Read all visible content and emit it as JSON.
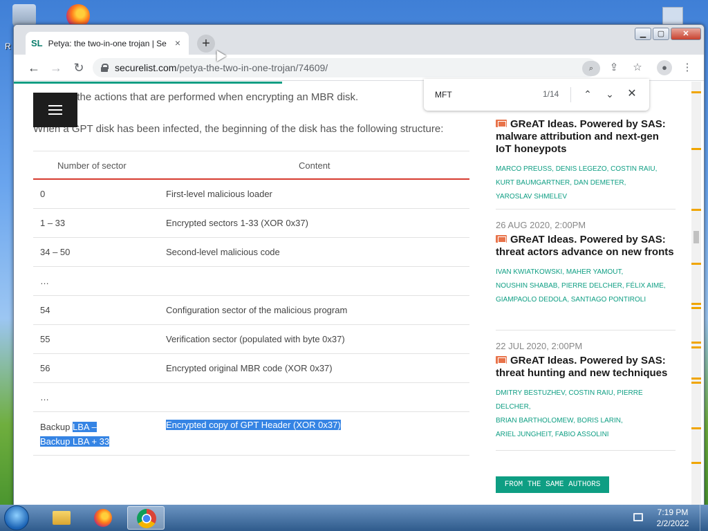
{
  "browser": {
    "tab": {
      "favicon": "SL",
      "title": "Petya: the two-in-one trojan | Se",
      "close": "×"
    },
    "new_tab": "+",
    "window_controls": {
      "minimize": "▁",
      "maximize": "▢",
      "close": "✕"
    },
    "nav": {
      "back": "←",
      "forward": "→",
      "reload": "↻"
    },
    "url_domain": "securelist.com",
    "url_path": "/petya-the-two-in-one-trojan/74609/",
    "icons": [
      "lock-icon",
      "find-icon",
      "share-icon",
      "star-icon",
      "profile-icon",
      "menu-icon"
    ]
  },
  "find_bar": {
    "query": "MFT",
    "count": "1/14",
    "prev": "⌃",
    "next": "⌄",
    "close": "✕"
  },
  "article": {
    "para1": "…rms all the actions that are performed when encrypting an MBR disk.",
    "para2": "When a GPT disk has been infected, the beginning of the disk has the following structure:",
    "table": {
      "headers": [
        "Number of sector",
        "Content"
      ],
      "rows": [
        [
          "0",
          "First-level malicious loader"
        ],
        [
          "1 – 33",
          "Encrypted sectors 1-33 (XOR 0x37)"
        ],
        [
          "34 – 50",
          "Second-level malicious code"
        ],
        [
          "…",
          ""
        ],
        [
          "54",
          "Configuration sector of the malicious program"
        ],
        [
          "55",
          "Verification sector (populated with byte 0x37)"
        ],
        [
          "56",
          "Encrypted original MBR code (XOR 0x37)"
        ],
        [
          "…",
          ""
        ]
      ],
      "last_row": {
        "c1_plain": "Backup ",
        "c1_sel_a": "LBA –",
        "c1_sel_b": "Backup LBA + 33",
        "c2": "Encrypted copy of GPT Header (XOR 0x37)"
      }
    }
  },
  "sidebar": {
    "posts": [
      {
        "date": "",
        "title": "GReAT Ideas. Powered by SAS: malware attribution and next-gen IoT honeypots",
        "authors": [
          "MARCO PREUSS",
          "DENIS LEGEZO",
          "COSTIN RAIU",
          "KURT BAUMGARTNER",
          "DAN DEMETER",
          "YAROSLAV SHMELEV"
        ]
      },
      {
        "date": "26 AUG 2020, 2:00PM",
        "title": "GReAT Ideas. Powered by SAS: threat actors advance on new fronts",
        "authors": [
          "IVAN KWIATKOWSKI",
          "MAHER YAMOUT",
          "NOUSHIN SHABAB",
          "PIERRE DELCHER",
          "FÉLIX AIME",
          "GIAMPAOLO DEDOLA",
          "SANTIAGO PONTIROLI"
        ]
      },
      {
        "date": "22 JUL 2020, 2:00PM",
        "title": "GReAT Ideas. Powered by SAS: threat hunting and new techniques",
        "authors": [
          "DMITRY BESTUZHEV",
          "COSTIN RAIU",
          "PIERRE DELCHER",
          "BRIAN BARTHOLOMEW",
          "BORIS LARIN",
          "ARIEL JUNGHEIT",
          "FABIO ASSOLINI"
        ]
      }
    ],
    "same_authors_button": "FROM THE SAME AUTHORS"
  },
  "taskbar": {
    "apps": [
      "windows-explorer",
      "firefox",
      "chrome"
    ],
    "time": "7:19 PM",
    "date": "2/2/2022"
  },
  "colors": {
    "accent": "#0e9e83",
    "table_rule": "#d63a2f",
    "selection": "#3584e4",
    "post_icon": "#e8734a"
  }
}
